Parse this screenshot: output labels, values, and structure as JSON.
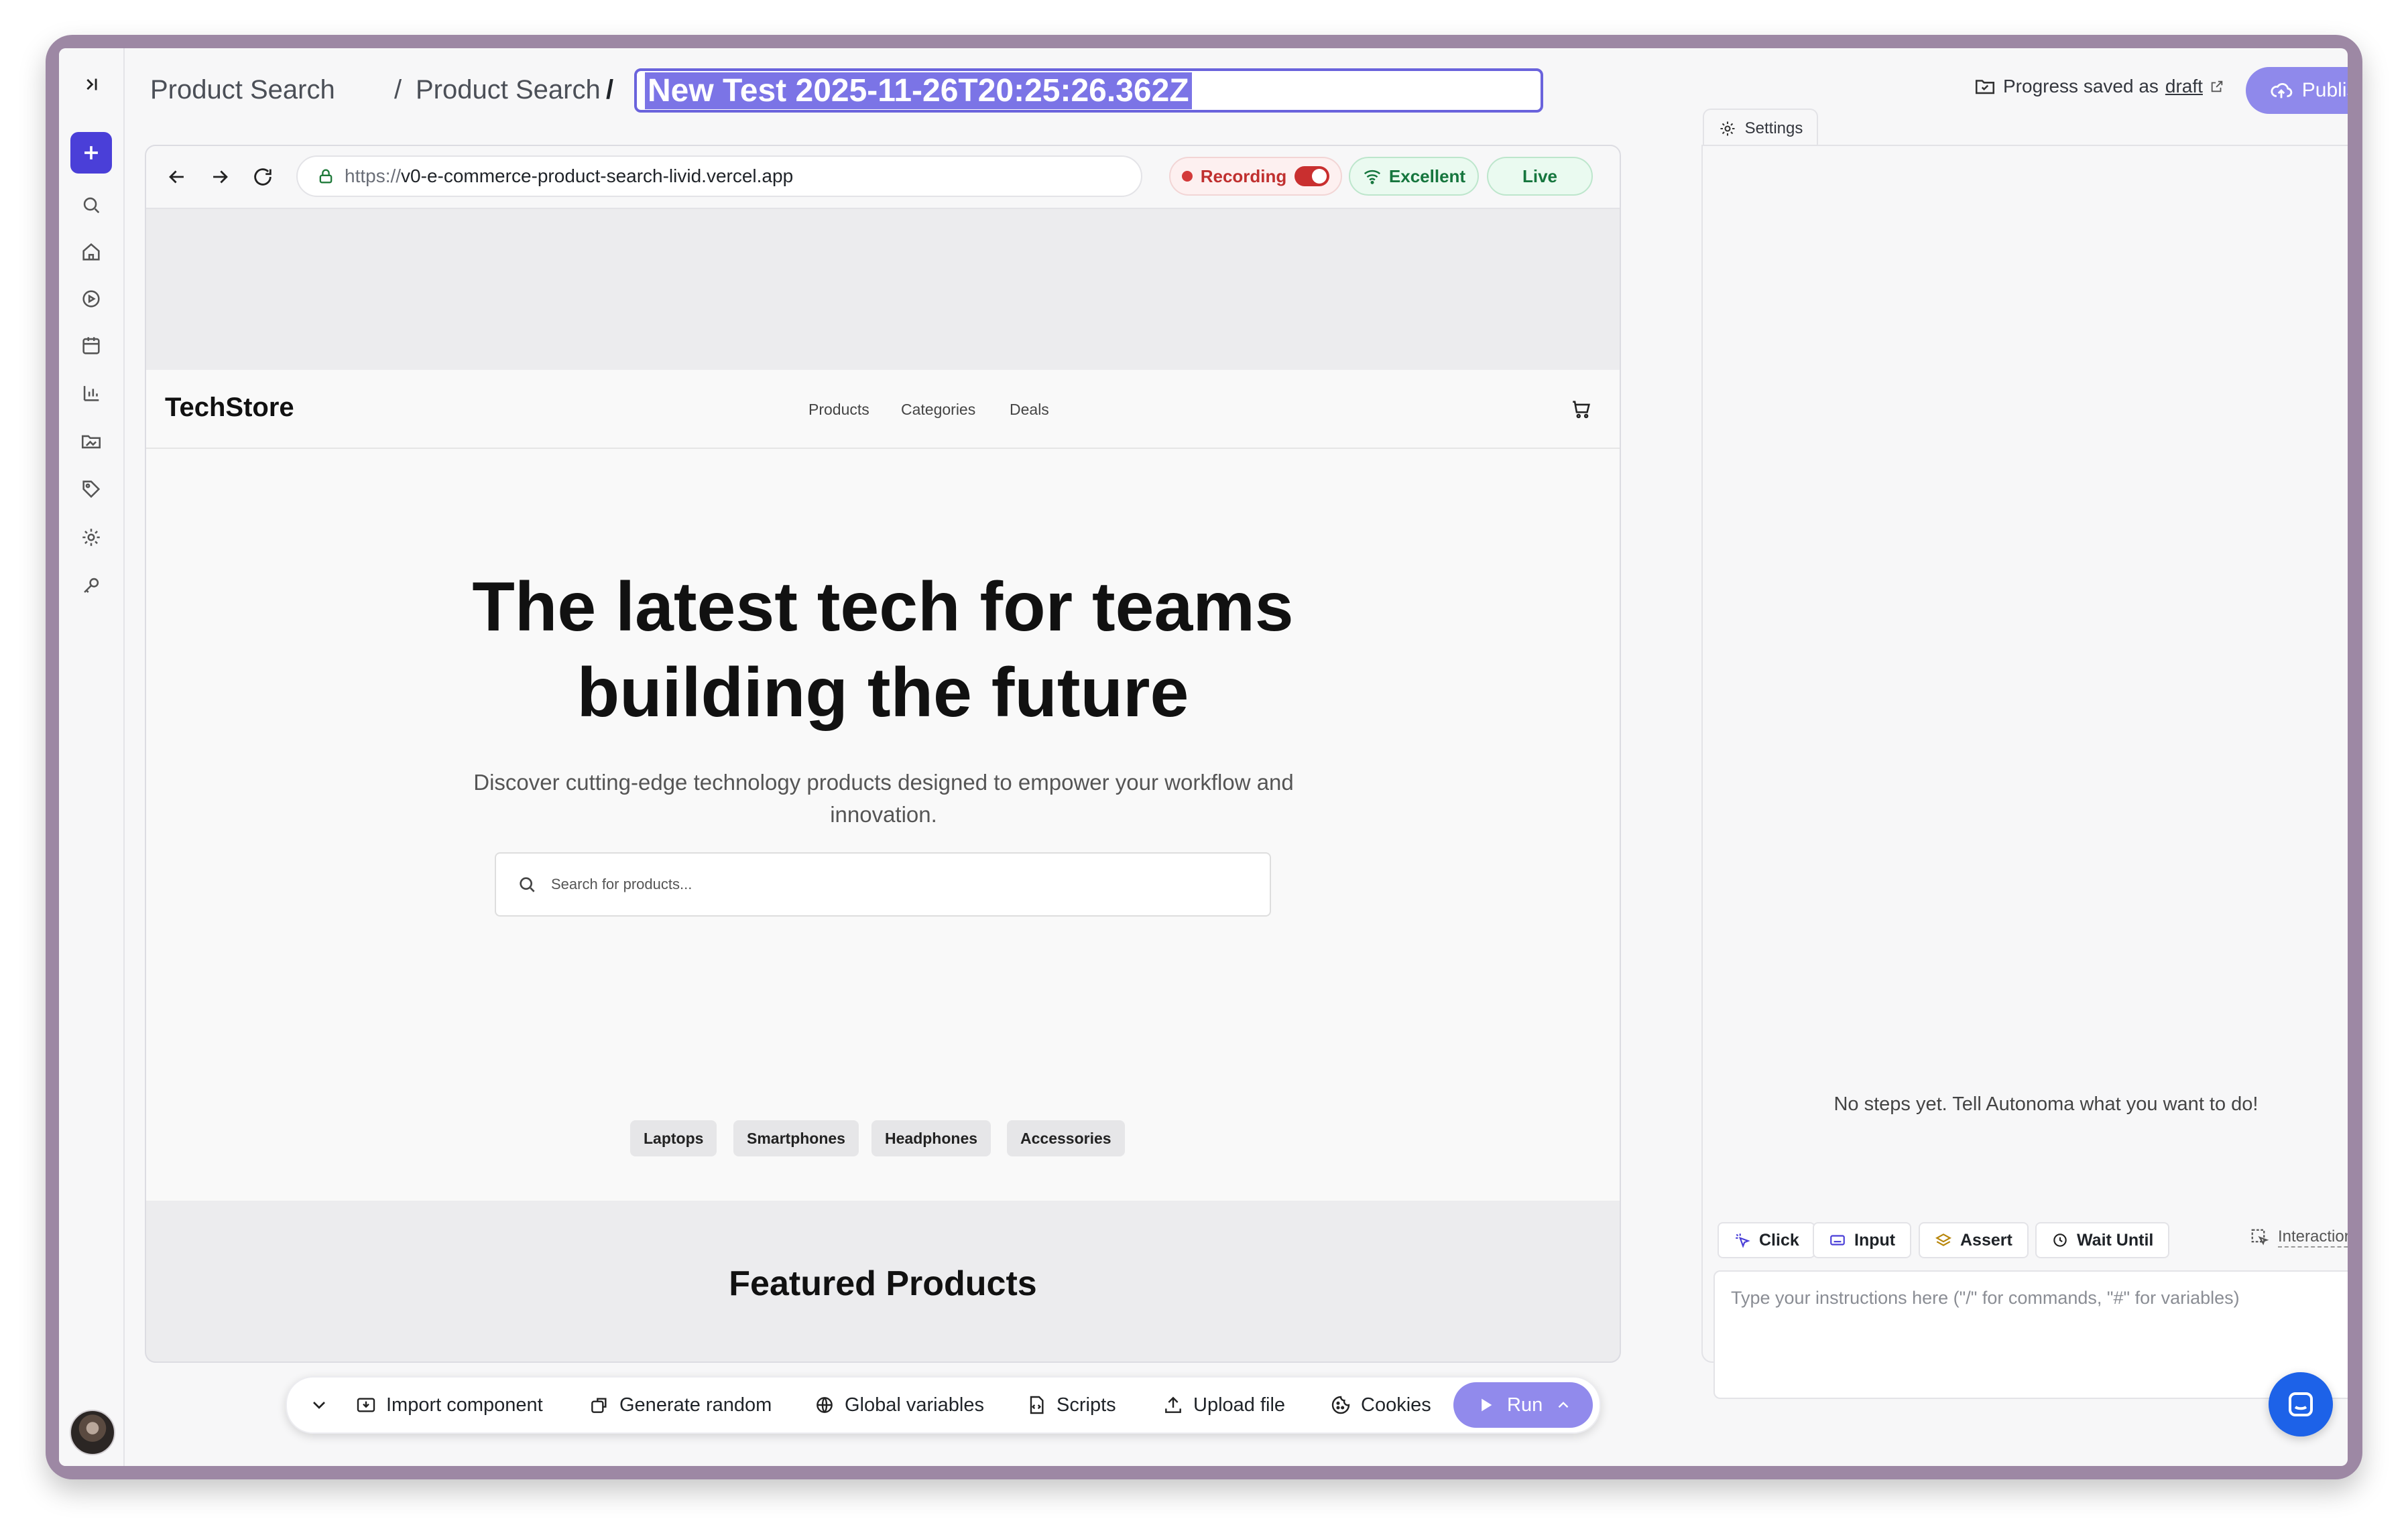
{
  "header": {
    "breadcrumb": [
      "Product Search",
      "Product Search"
    ],
    "separator": "/",
    "test_title": "New Test 2025-11-26T20:25:26.362Z",
    "progress_text": "Progress saved as",
    "progress_link": "draft",
    "publish_label": "Publish"
  },
  "browser": {
    "url_protocol": "https://",
    "url_host": "v0-e-commerce-product-search-livid.vercel.app",
    "recording_label": "Recording",
    "connection_label": "Excellent",
    "live_label": "Live"
  },
  "site": {
    "brand": "TechStore",
    "nav": [
      "Products",
      "Categories",
      "Deals"
    ],
    "hero_line1": "The latest tech for teams",
    "hero_line2": "building the future",
    "subtitle": "Discover cutting-edge technology products designed to empower your workflow and innovation.",
    "search_placeholder": "Search for products...",
    "tags": [
      "Laptops",
      "Smartphones",
      "Headphones",
      "Accessories"
    ],
    "featured_heading": "Featured Products"
  },
  "toolbar": {
    "import_label": "Import component",
    "generate_label": "Generate random",
    "globals_label": "Global variables",
    "scripts_label": "Scripts",
    "upload_label": "Upload file",
    "cookies_label": "Cookies",
    "run_label": "Run"
  },
  "panel": {
    "tab_label": "Settings",
    "empty_message": "No steps yet. Tell Autonoma what you want to do!",
    "commands": [
      "Click",
      "Input",
      "Assert",
      "Wait Until"
    ],
    "interactions_label": "Interactions",
    "instructions_placeholder": "Type your instructions here (\"/\" for commands, \"#\" for variables)"
  },
  "colors": {
    "accent": "#4a3fd8",
    "publish": "#8f89eb",
    "recording": "#c92f2f",
    "status_green": "#16763e",
    "chat": "#1d62e8"
  },
  "icons": [
    "collapse-sidebar-icon",
    "plus-icon",
    "search-icon",
    "home-icon",
    "play-icon",
    "schedule-icon",
    "chart-icon",
    "folder-icon",
    "tag-icon",
    "gear-icon",
    "key-icon",
    "back-icon",
    "forward-icon",
    "reload-icon",
    "lock-icon",
    "wifi-icon",
    "cart-icon",
    "chevron-down-icon",
    "import-icon",
    "generate-icon",
    "globe-icon",
    "script-icon",
    "upload-icon",
    "cookie-icon",
    "play-icon",
    "chevron-up-icon",
    "sparkle-icon",
    "keyboard-icon",
    "layers-icon",
    "clock-icon",
    "interactions-icon",
    "chat-icon"
  ]
}
